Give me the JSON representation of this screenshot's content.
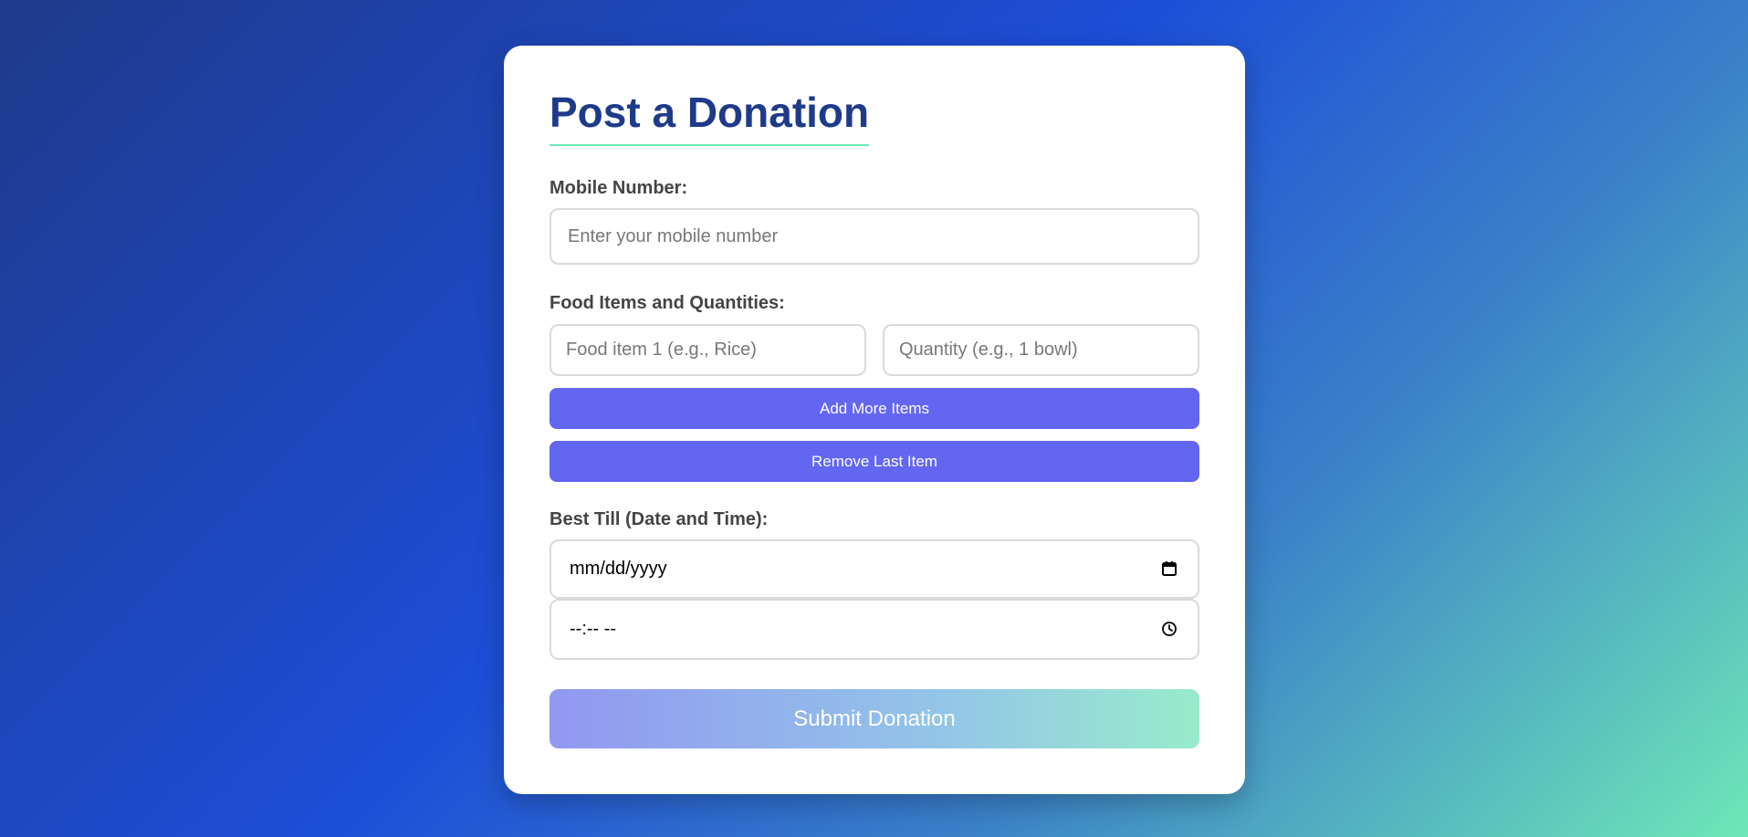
{
  "form": {
    "title": "Post a Donation",
    "mobile": {
      "label": "Mobile Number:",
      "placeholder": "Enter your mobile number",
      "value": ""
    },
    "food": {
      "label": "Food Items and Quantities:",
      "item_placeholder": "Food item 1 (e.g., Rice)",
      "quantity_placeholder": "Quantity (e.g., 1 bowl)",
      "add_label": "Add More Items",
      "remove_label": "Remove Last Item"
    },
    "best_till": {
      "label": "Best Till (Date and Time):",
      "date_value": "mm/dd/yyyy",
      "time_value": "--:-- --",
      "date_icon": "calendar-icon",
      "time_icon": "clock-icon"
    },
    "submit_label": "Submit Donation"
  },
  "colors": {
    "title": "#1e3a8a",
    "accent": "#6366f1",
    "underline": "#6ee7b7"
  }
}
